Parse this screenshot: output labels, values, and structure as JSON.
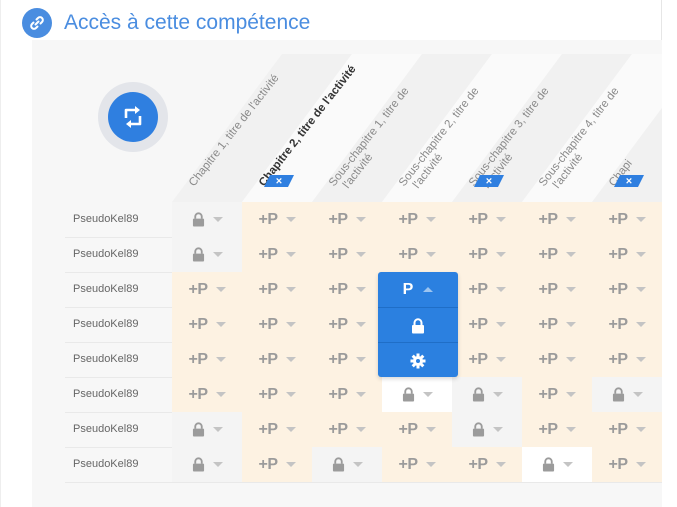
{
  "header": {
    "title": "Accès à cette compétence",
    "link_icon": "link-icon",
    "refresh_icon": "refresh-icon"
  },
  "columns": [
    {
      "label": "Chapitre 1, titre de l'activité",
      "bold": false,
      "badge": false
    },
    {
      "label": "Chapitre 2, titre de l'activité",
      "bold": true,
      "badge": true
    },
    {
      "label": "Sous-chapitre 1, titre de l'activité",
      "bold": false,
      "badge": false
    },
    {
      "label": "Sous-chapitre 2, titre de l'activité",
      "bold": false,
      "badge": false
    },
    {
      "label": "Sous-chapitre 3, titre de l'activité",
      "bold": false,
      "badge": true
    },
    {
      "label": "Sous-chapitre 4, titre de l'activité",
      "bold": false,
      "badge": false
    },
    {
      "label": "Chapi",
      "bold": false,
      "badge": true
    }
  ],
  "badge_symbol": "×",
  "plus_p": "+P",
  "rows": [
    {
      "name": "PseudoKel89",
      "cells": [
        "lock",
        "plus",
        "plus",
        "plus",
        "plus",
        "plus",
        "plus"
      ],
      "bg": [
        "light",
        "cream",
        "cream",
        "cream",
        "cream",
        "cream",
        "cream"
      ]
    },
    {
      "name": "PseudoKel89",
      "cells": [
        "lock",
        "plus",
        "plus",
        "plus",
        "plus",
        "plus",
        "plus"
      ],
      "bg": [
        "light",
        "cream",
        "cream",
        "cream",
        "cream",
        "cream",
        "cream"
      ]
    },
    {
      "name": "PseudoKel89",
      "cells": [
        "plus",
        "plus",
        "plus",
        "open",
        "plus",
        "plus",
        "plus"
      ],
      "bg": [
        "cream",
        "cream",
        "cream",
        "cream",
        "cream",
        "cream",
        "cream"
      ]
    },
    {
      "name": "PseudoKel89",
      "cells": [
        "plus",
        "plus",
        "plus",
        "hidden",
        "plus",
        "plus",
        "plus"
      ],
      "bg": [
        "cream",
        "cream",
        "cream",
        "cream",
        "cream",
        "cream",
        "cream"
      ]
    },
    {
      "name": "PseudoKel89",
      "cells": [
        "plus",
        "plus",
        "plus",
        "hidden",
        "plus",
        "plus",
        "plus"
      ],
      "bg": [
        "cream",
        "cream",
        "cream",
        "cream",
        "cream",
        "cream",
        "cream"
      ]
    },
    {
      "name": "PseudoKel89",
      "cells": [
        "plus",
        "plus",
        "plus",
        "lock",
        "lock",
        "plus",
        "lock"
      ],
      "bg": [
        "cream",
        "cream",
        "cream",
        "white",
        "light",
        "cream",
        "light"
      ]
    },
    {
      "name": "PseudoKel89",
      "cells": [
        "lock",
        "plus",
        "plus",
        "plus",
        "lock",
        "plus",
        "plus"
      ],
      "bg": [
        "light",
        "cream",
        "cream",
        "cream",
        "light",
        "cream",
        "cream"
      ]
    },
    {
      "name": "PseudoKel89",
      "cells": [
        "lock",
        "plus",
        "lock",
        "plus",
        "plus",
        "lock",
        "plus"
      ],
      "bg": [
        "light",
        "cream",
        "light",
        "cream",
        "cream",
        "white",
        "cream"
      ]
    }
  ],
  "dropdown": {
    "items": [
      {
        "label": "P",
        "icon": "chevron-up-icon"
      },
      {
        "label": "",
        "icon": "lock-icon"
      },
      {
        "label": "",
        "icon": "gear-icon"
      }
    ]
  }
}
